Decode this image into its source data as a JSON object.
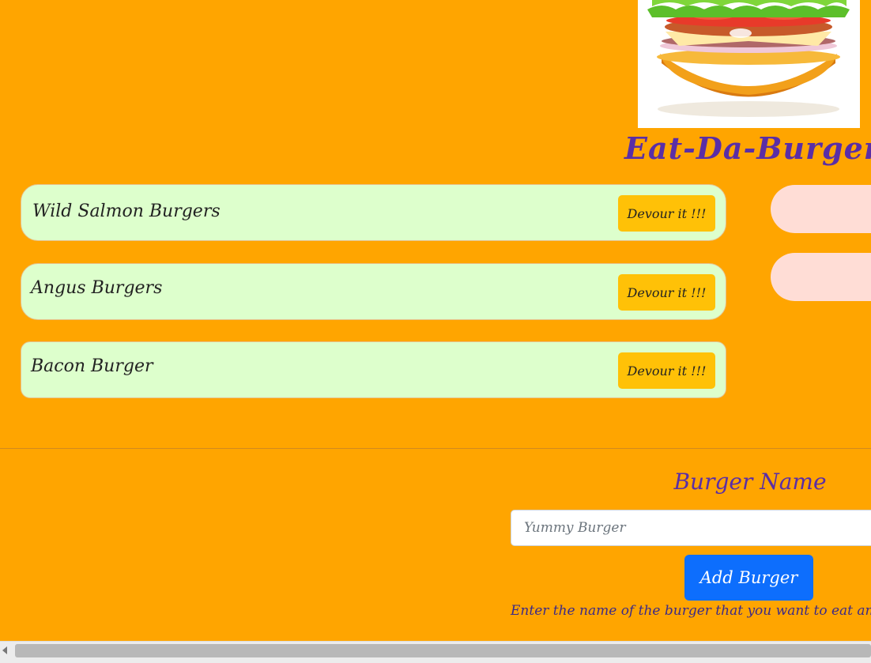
{
  "header": {
    "title": "Eat-Da-Burger!",
    "image_icon": "burger-icon"
  },
  "burgers_to_eat": [
    {
      "name": "Wild Salmon Burgers",
      "button_label": "Devour it !!!"
    },
    {
      "name": "Angus Burgers",
      "button_label": "Devour it !!!"
    },
    {
      "name": "Bacon Burger",
      "button_label": "Devour it !!!"
    }
  ],
  "form": {
    "label": "Burger Name",
    "input_value": "",
    "input_placeholder": "Yummy Burger",
    "submit_label": "Add Burger",
    "help_text": "Enter the name of the burger that you want to eat and cli"
  },
  "colors": {
    "page_background": "#FFA500",
    "card_background": "#DDFFCC",
    "devour_button": "#FFC107",
    "devoured_pill": "#FFDDD6",
    "submit_button": "#0D6EFD",
    "title_text": "#5A2EA6"
  }
}
